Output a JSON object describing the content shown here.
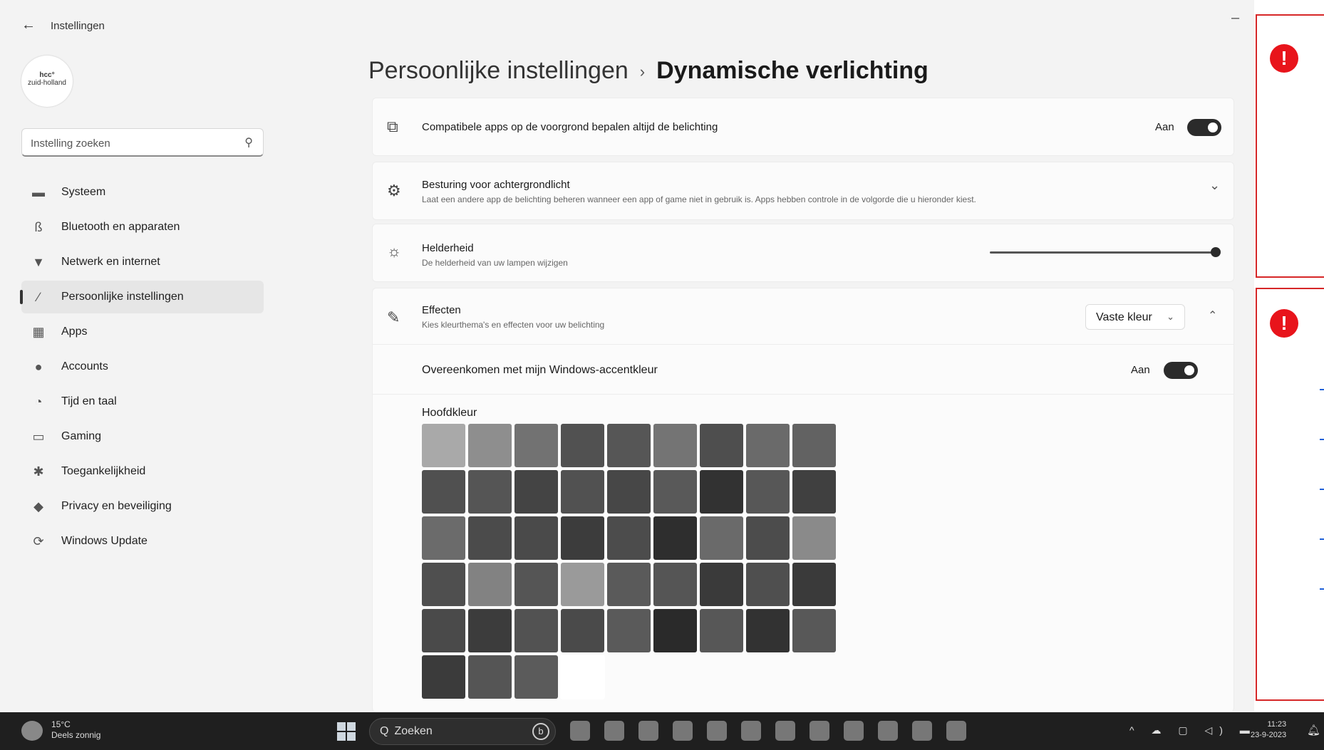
{
  "window": {
    "back": "←",
    "title": "Instellingen",
    "minimize": "–"
  },
  "account": {
    "logo_line1": "hcc°",
    "logo_line2": "zuid-holland"
  },
  "search": {
    "placeholder": "Instelling zoeken",
    "icon": "⚲"
  },
  "sidebar": {
    "items": [
      {
        "label": "Systeem",
        "icon": "monitor-icon",
        "glyph": "▬",
        "selected": false
      },
      {
        "label": "Bluetooth en apparaten",
        "icon": "bluetooth-icon",
        "glyph": "ß",
        "selected": false
      },
      {
        "label": "Netwerk en internet",
        "icon": "wifi-icon",
        "glyph": "▼",
        "selected": false
      },
      {
        "label": "Persoonlijke instellingen",
        "icon": "brush-icon",
        "glyph": "∕",
        "selected": true
      },
      {
        "label": "Apps",
        "icon": "apps-icon",
        "glyph": "▦",
        "selected": false
      },
      {
        "label": "Accounts",
        "icon": "person-icon",
        "glyph": "●",
        "selected": false
      },
      {
        "label": "Tijd en taal",
        "icon": "globe-clock-icon",
        "glyph": "◔",
        "selected": false
      },
      {
        "label": "Gaming",
        "icon": "gamepad-icon",
        "glyph": "▭",
        "selected": false
      },
      {
        "label": "Toegankelijkheid",
        "icon": "accessibility-icon",
        "glyph": "✱",
        "selected": false
      },
      {
        "label": "Privacy en beveiliging",
        "icon": "shield-icon",
        "glyph": "◆",
        "selected": false
      },
      {
        "label": "Windows Update",
        "icon": "update-icon",
        "glyph": "⟳",
        "selected": false
      }
    ]
  },
  "breadcrumb": {
    "parent": "Persoonlijke instellingen",
    "separator": "›",
    "current": "Dynamische verlichting"
  },
  "cards": {
    "foreground": {
      "icon": "apps-lighting-icon",
      "glyph": "⧉",
      "title": "Compatibele apps op de voorgrond bepalen altijd de belichting",
      "toggle_label": "Aan",
      "on": true
    },
    "background": {
      "icon": "gear-icon",
      "glyph": "⚙",
      "title": "Besturing voor achtergrondlicht",
      "subtitle": "Laat een andere app de belichting beheren wanneer een app of game niet in gebruik is. Apps hebben controle in de volgorde die u hieronder kiest.",
      "chevron": "⌄"
    },
    "brightness": {
      "icon": "sun-icon",
      "glyph": "☼",
      "title": "Helderheid",
      "subtitle": "De helderheid van uw lampen wijzigen",
      "value": 100
    },
    "effects": {
      "icon": "pen-icon",
      "glyph": "✎",
      "title": "Effecten",
      "subtitle": "Kies kleurthema's en effecten voor uw belichting",
      "dropdown_value": "Vaste kleur",
      "dropdown_chevron": "⌄",
      "collapse": "⌃",
      "accent_label": "Overeenkomen met mijn Windows-accentkleur",
      "accent_toggle_label": "Aan",
      "accent_on": true,
      "main_color_label": "Hoofdkleur",
      "swatches": [
        "#a9a9a9",
        "#8e8e8e",
        "#727272",
        "#515151",
        "#565656",
        "#747474",
        "#4e4e4e",
        "#6a6a6a",
        "#626262",
        "#505050",
        "#555555",
        "#444444",
        "#515151",
        "#474747",
        "#595959",
        "#323232",
        "#575757",
        "#404040",
        "#6b6b6b",
        "#4b4b4b",
        "#4a4a4a",
        "#3c3c3c",
        "#4c4c4c",
        "#2e2e2e",
        "#6a6a6a",
        "#4c4c4c",
        "#8a8a8a",
        "#4f4f4f",
        "#828282",
        "#555555",
        "#9a9a9a",
        "#5a5a5a",
        "#555555",
        "#3a3a3a",
        "#4f4f4f",
        "#3a3a3a",
        "#4a4a4a",
        "#3c3c3c",
        "#525252",
        "#4a4a4a",
        "#5a5a5a",
        "#2a2a2a",
        "#575757",
        "#323232",
        "#585858",
        "#3b3b3b",
        "#555555",
        "#5b5b5b",
        "#ffffff"
      ]
    }
  },
  "taskbar": {
    "weather_temp": "15°C",
    "weather_desc": "Deels zonnig",
    "search_label": "Zoeken",
    "search_icon": "Q",
    "bing": "b",
    "pinned": [
      "taskview-icon",
      "teams-icon",
      "edge-icon",
      "explorer-icon",
      "onenote-icon",
      "excel-icon",
      "photos-icon",
      "word-icon",
      "app-icon",
      "app2-icon",
      "app3-icon",
      "settings-icon"
    ],
    "tray": "^ ☁ ▢ ◁) ▬",
    "time": "11:23",
    "date": "23-9-2023",
    "bell": "🔔︎"
  },
  "overlay": {
    "warning_glyph": "!"
  }
}
